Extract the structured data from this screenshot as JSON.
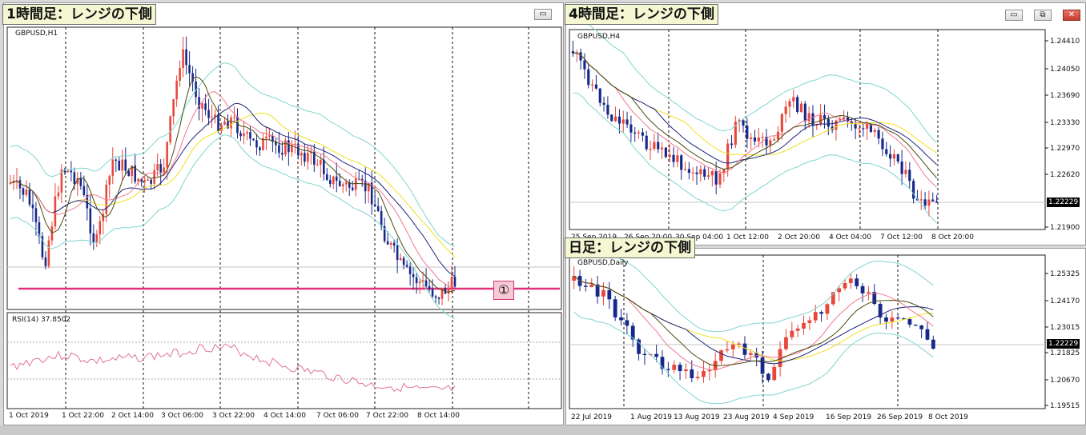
{
  "panels": {
    "h1": {
      "title": "1時間足：レンジの下側",
      "symbol": "GBPUSD,H1",
      "rsi_label": "RSI(14) 37.8502",
      "marker": "①",
      "x_labels": [
        "1 Oct 2019",
        "1 Oct 22:00",
        "2 Oct 14:00",
        "3 Oct 06:00",
        "3 Oct 22:00",
        "4 Oct 14:00",
        "7 Oct 06:00",
        "7 Oct 22:00",
        "8 Oct 14:00"
      ]
    },
    "h4": {
      "title": "4時間足：レンジの下側",
      "symbol": "GBPUSD,H4",
      "price_labels": [
        "1.24410",
        "1.24050",
        "1.23690",
        "1.23330",
        "1.22970",
        "1.22620",
        "1.21900"
      ],
      "current_price": "1.22229",
      "x_labels": [
        "25 Sep 2019",
        "26 Sep 20:00",
        "30 Sep 04:00",
        "1 Oct 12:00",
        "2 Oct 20:00",
        "4 Oct 04:00",
        "7 Oct 12:00",
        "8 Oct 20:00"
      ]
    },
    "daily": {
      "title": "日足：レンジの下側",
      "symbol": "GBPUSD,Daily",
      "price_labels": [
        "1.25325",
        "1.24170",
        "1.23015",
        "1.21825",
        "1.20670",
        "1.19515"
      ],
      "current_price": "1.22229",
      "x_labels": [
        "22 Jul 2019",
        "1 Aug 2019",
        "13 Aug 2019",
        "23 Aug 2019",
        "4 Sep 2019",
        "16 Sep 2019",
        "26 Sep 2019",
        "8 Oct 2019"
      ]
    }
  },
  "window_controls": {
    "minimize_glyph": "▭",
    "restore_glyph": "⧉",
    "close_glyph": "✕"
  },
  "colors": {
    "bull": "#e8473a",
    "bear": "#16288a",
    "bollinger": "#7fd6cf",
    "ma_yellow": "#f0e020",
    "ma_navy": "#1a237e",
    "ma_pink": "#f07890",
    "ma_dark": "#4a4a10",
    "rsi": "#e07590",
    "support_line": "#e0307a"
  }
}
